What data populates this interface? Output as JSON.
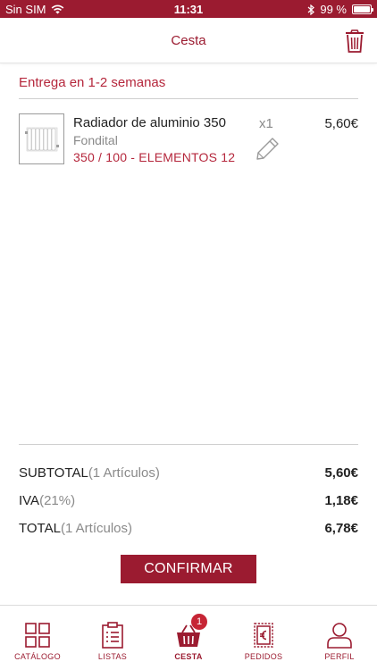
{
  "status_bar": {
    "carrier": "Sin SIM",
    "time": "11:31",
    "battery": "99 %",
    "battery_level": 0.99
  },
  "header": {
    "title": "Cesta"
  },
  "delivery": {
    "text": "Entrega en 1-2 semanas"
  },
  "item": {
    "name": "Radiador de aluminio 350",
    "brand": "Fondital",
    "variant": "350 / 100 - ELEMENTOS 12",
    "quantity": "x1",
    "price": "5,60€"
  },
  "totals": {
    "subtotal_label": "SUBTOTAL",
    "subtotal_sub": "(1 Artículos)",
    "subtotal_value": "5,60€",
    "iva_label": "IVA",
    "iva_sub": "(21%)",
    "iva_value": "1,18€",
    "total_label": "TOTAL",
    "total_sub": "(1 Artículos)",
    "total_value": "6,78€"
  },
  "confirm_label": "CONFIRMAR",
  "tabs": [
    {
      "label": "CATÁLOGO",
      "icon": "grid-icon"
    },
    {
      "label": "LISTAS",
      "icon": "list-icon"
    },
    {
      "label": "CESTA",
      "icon": "basket-icon",
      "badge": "1"
    },
    {
      "label": "PEDIDOS",
      "icon": "euro-receipt-icon"
    },
    {
      "label": "PERFIL",
      "icon": "user-icon"
    }
  ],
  "colors": {
    "brand": "#9b1b30",
    "accent_text": "#b5273c",
    "badge": "#c62535"
  }
}
